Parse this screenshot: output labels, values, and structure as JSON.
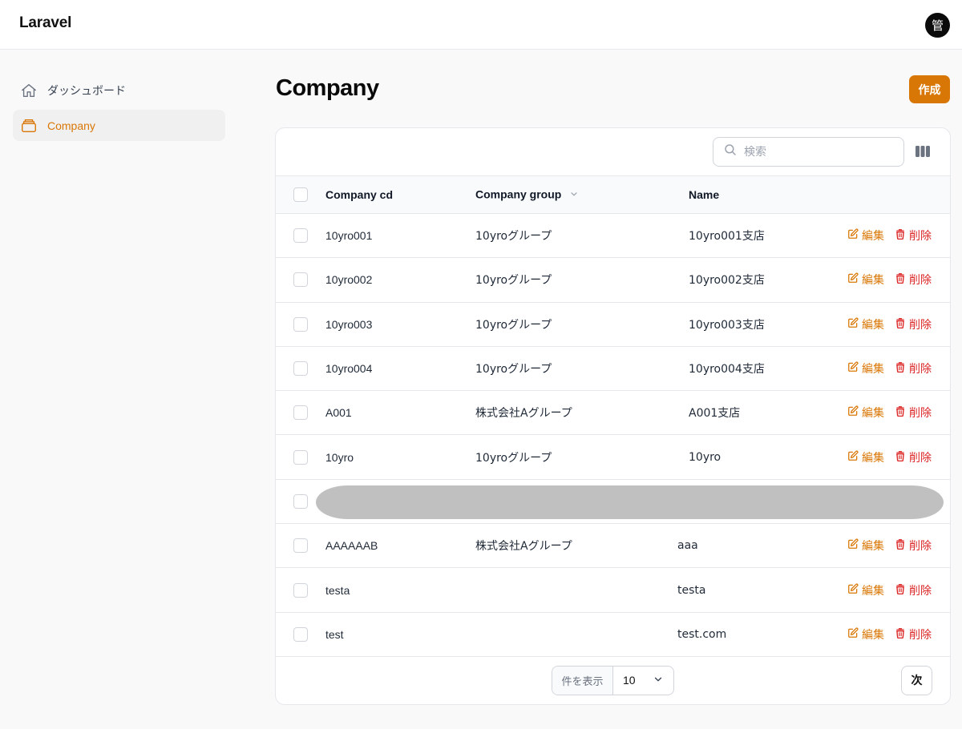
{
  "app": {
    "brand": "Laravel",
    "user_avatar": "管"
  },
  "sidebar": {
    "items": [
      {
        "label": "ダッシュボード",
        "icon": "home-icon",
        "active": false
      },
      {
        "label": "Company",
        "icon": "inbox-stack-icon",
        "active": true
      }
    ]
  },
  "page": {
    "title": "Company",
    "create_label": "作成"
  },
  "table": {
    "search_placeholder": "検索",
    "columns": {
      "cd": "Company cd",
      "group": "Company group",
      "name": "Name"
    },
    "row_actions": {
      "edit": "編集",
      "delete": "削除"
    },
    "rows": [
      {
        "cd": "10yro001",
        "group": "10yroグループ",
        "name": "10yro001支店"
      },
      {
        "cd": "10yro002",
        "group": "10yroグループ",
        "name": "10yro002支店"
      },
      {
        "cd": "10yro003",
        "group": "10yroグループ",
        "name": "10yro003支店"
      },
      {
        "cd": "10yro004",
        "group": "10yroグループ",
        "name": "10yro004支店"
      },
      {
        "cd": "A001",
        "group": "株式会社Aグループ",
        "name": "A001支店"
      },
      {
        "cd": "10yro",
        "group": "10yroグループ",
        "name": "10yro"
      },
      {
        "cd": "AAAAAAB",
        "group": "株式会社Aグループ",
        "name": "aaa"
      },
      {
        "cd": "testa",
        "group": "",
        "name": "testa"
      },
      {
        "cd": "test",
        "group": "",
        "name": "test.com"
      }
    ]
  },
  "pagination": {
    "per_page_label": "件を表示",
    "per_page_value": "10",
    "next_label": "次"
  },
  "colors": {
    "accent": "#d97706",
    "danger": "#dc2626",
    "redacted": "#c0c0c0"
  }
}
